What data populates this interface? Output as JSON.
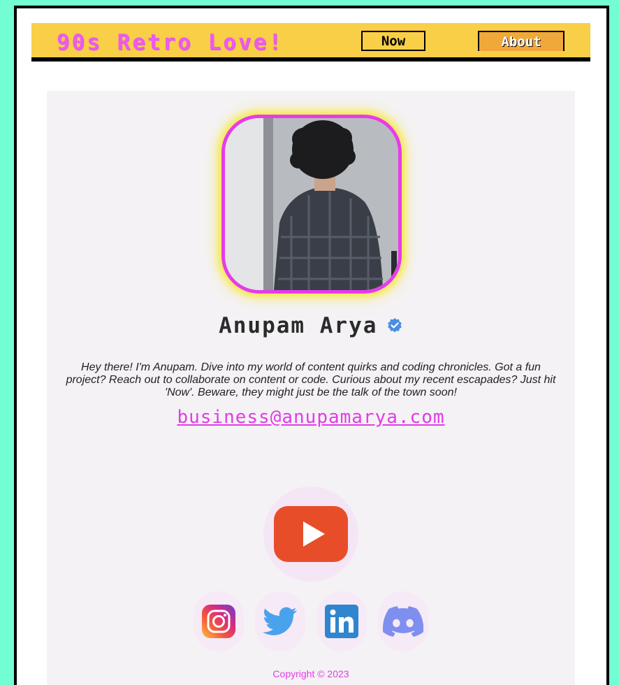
{
  "nav": {
    "brand": "90s Retro Love!",
    "links": [
      {
        "label": "Now"
      },
      {
        "label": "About"
      }
    ]
  },
  "profile": {
    "name": "Anupam Arya",
    "verified_icon": "verified-badge-icon",
    "bio": "Hey there! I'm Anupam. Dive into my world of content quirks and coding chronicles. Got a fun project? Reach out to collaborate on content or code. Curious about my recent escapades? Just hit 'Now'. Beware, they might just be the talk of the town soon!",
    "email": "business@anupamarya.com"
  },
  "socials": {
    "featured": "youtube-icon",
    "items": [
      "instagram-icon",
      "twitter-icon",
      "linkedin-icon",
      "discord-icon"
    ]
  },
  "footer": {
    "copyright": "Copyright © 2023"
  },
  "colors": {
    "background": "#72fdd2",
    "navbar": "#f8cf46",
    "accent_pink": "#e13ce7",
    "about_button": "#f0a83a"
  }
}
